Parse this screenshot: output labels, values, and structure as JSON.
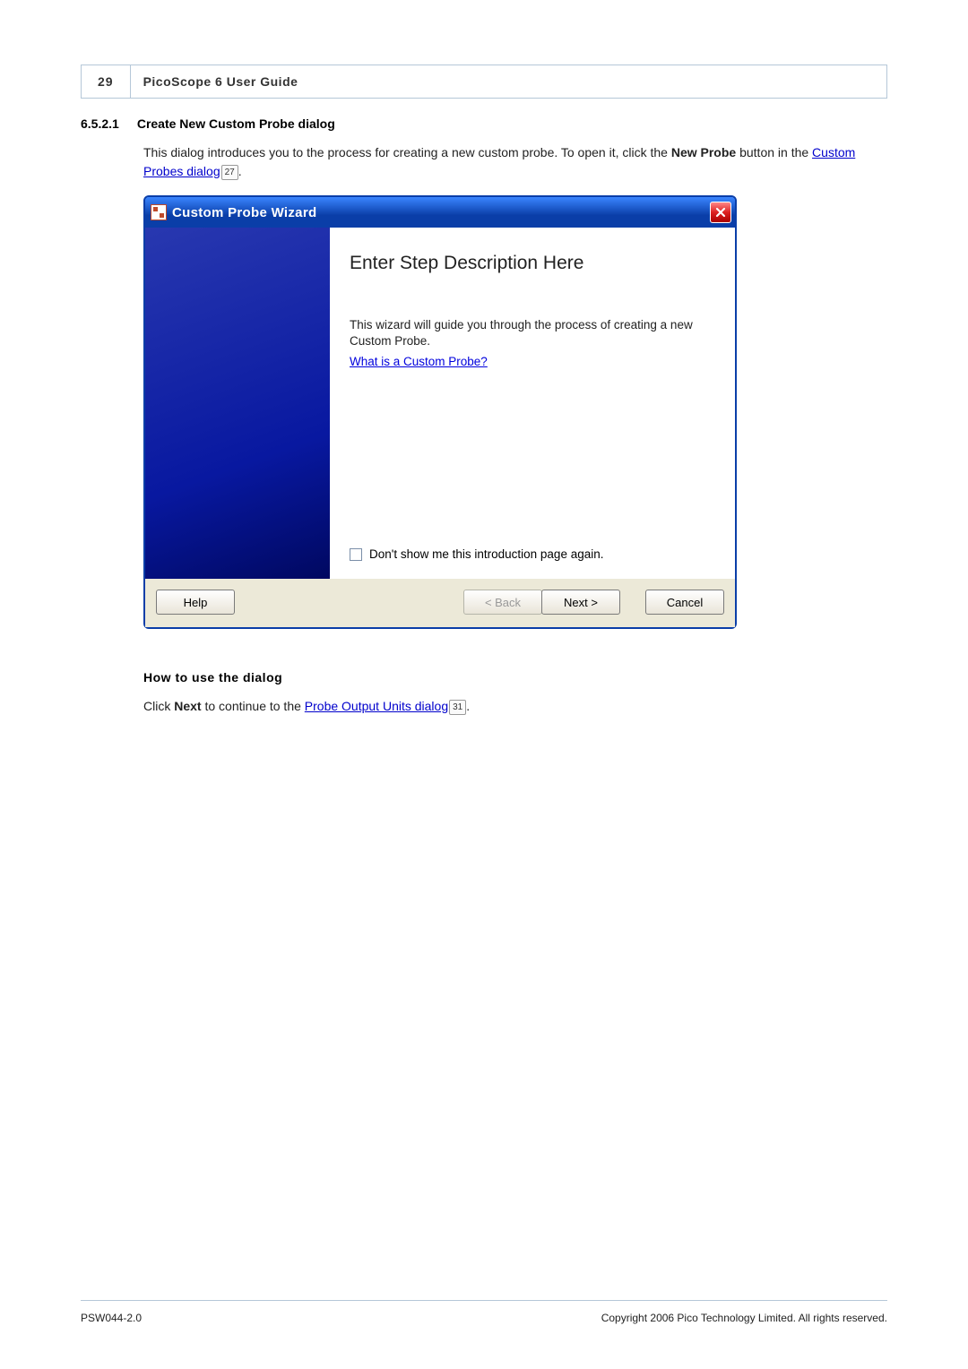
{
  "header": {
    "page_number": "29",
    "title": "PicoScope 6 User Guide"
  },
  "section": {
    "number": "6.5.2.1",
    "title": "Create New Custom Probe dialog"
  },
  "intro": {
    "part1": "This dialog introduces you to the process for creating a new custom probe. To open it, click the ",
    "bold1": "New Probe",
    "part2": " button in the ",
    "link1": "Custom Probes dialog",
    "ref1": "27",
    "part3": "."
  },
  "wizard": {
    "title": "Custom Probe Wizard",
    "step_title": "Enter Step Description Here",
    "description": "This wizard will guide you through the process of creating a new Custom Probe.",
    "link": "What is a Custom Probe?",
    "checkbox_label": "Don't show me this introduction page again.",
    "buttons": {
      "help": "Help",
      "back": "< Back",
      "next": "Next >",
      "cancel": "Cancel"
    }
  },
  "howto": {
    "heading": "How to use the dialog",
    "part1": "Click ",
    "bold1": "Next",
    "part2": " to continue to the ",
    "link1": "Probe Output Units dialog",
    "ref1": "31",
    "part3": "."
  },
  "footer": {
    "left": "PSW044-2.0",
    "right": "Copyright 2006 Pico Technology Limited. All rights reserved."
  }
}
